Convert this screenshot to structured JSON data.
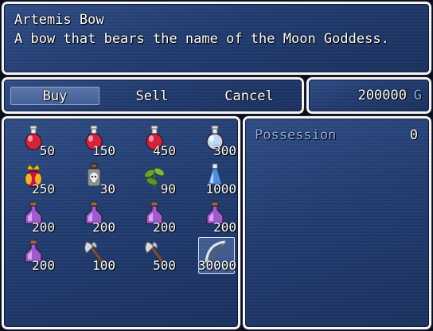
{
  "help": {
    "name": "Artemis Bow",
    "description": "A bow that bears the name of the Moon Goddess."
  },
  "commands": {
    "buy": "Buy",
    "sell": "Sell",
    "cancel": "Cancel",
    "selected": "Buy"
  },
  "gold": {
    "amount": "200000",
    "unit": "G"
  },
  "items": [
    {
      "icon": "red-potion-icon",
      "price": "50"
    },
    {
      "icon": "red-potion-icon",
      "price": "150"
    },
    {
      "icon": "red-potion-icon",
      "price": "450"
    },
    {
      "icon": "blue-potion-icon",
      "price": "300"
    },
    {
      "icon": "crowned-elixir-icon",
      "price": "250"
    },
    {
      "icon": "skull-poison-bottle-icon",
      "price": "30"
    },
    {
      "icon": "herb-leaf-icon",
      "price": "90"
    },
    {
      "icon": "blue-tonic-icon",
      "price": "1000"
    },
    {
      "icon": "purple-flask-icon",
      "price": "200"
    },
    {
      "icon": "purple-flask-icon",
      "price": "200"
    },
    {
      "icon": "purple-flask-icon",
      "price": "200"
    },
    {
      "icon": "purple-flask-icon",
      "price": "200"
    },
    {
      "icon": "purple-flask-icon",
      "price": "200"
    },
    {
      "icon": "axe-icon",
      "price": "100"
    },
    {
      "icon": "axe-icon",
      "price": "500"
    },
    {
      "icon": "bow-icon",
      "price": "30000"
    }
  ],
  "selected_item_index": 15,
  "status": {
    "label": "Possession",
    "count": "0"
  },
  "colors": {
    "window": "#223c70",
    "border": "#f4f4f4",
    "system_text": "#8fb1ea"
  }
}
